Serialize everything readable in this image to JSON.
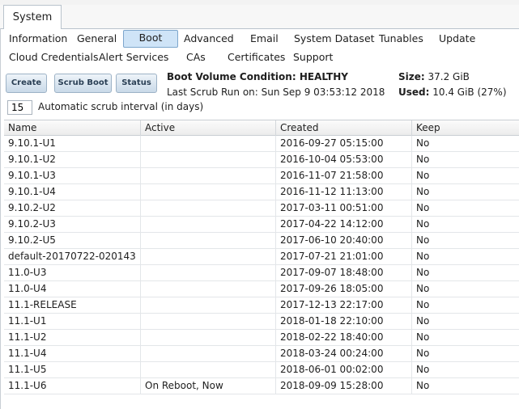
{
  "outer_tab": {
    "label": "System"
  },
  "subtabs": [
    {
      "label": "Information"
    },
    {
      "label": "General"
    },
    {
      "label": "Boot"
    },
    {
      "label": "Advanced"
    },
    {
      "label": "Email"
    },
    {
      "label": "System Dataset"
    },
    {
      "label": "Tunables"
    },
    {
      "label": "Update"
    },
    {
      "label": "Cloud Credentials"
    },
    {
      "label": "Alert Services"
    },
    {
      "label": "CAs"
    },
    {
      "label": "Certificates"
    },
    {
      "label": "Support"
    }
  ],
  "toolbar": {
    "create_label": "Create",
    "scrub_boot_label": "Scrub Boot",
    "status_label": "Status"
  },
  "boot_info": {
    "condition_label": "Boot Volume Condition:",
    "condition_value": "HEALTHY",
    "last_scrub": "Last Scrub Run on: Sun Sep 9 03:53:12 2018",
    "size_label": "Size:",
    "size_value": "37.2 GiB",
    "used_label": "Used:",
    "used_value": "10.4 GiB (27%)"
  },
  "scrub_interval": {
    "value": "15",
    "label": "Automatic scrub interval (in days)"
  },
  "table": {
    "columns": [
      "Name",
      "Active",
      "Created",
      "Keep"
    ],
    "rows": [
      {
        "name": "9.10.1-U1",
        "active": "",
        "created": "2016-09-27 05:15:00",
        "keep": "No"
      },
      {
        "name": "9.10.1-U2",
        "active": "",
        "created": "2016-10-04 05:53:00",
        "keep": "No"
      },
      {
        "name": "9.10.1-U3",
        "active": "",
        "created": "2016-11-07 21:58:00",
        "keep": "No"
      },
      {
        "name": "9.10.1-U4",
        "active": "",
        "created": "2016-11-12 11:13:00",
        "keep": "No"
      },
      {
        "name": "9.10.2-U2",
        "active": "",
        "created": "2017-03-11 00:51:00",
        "keep": "No"
      },
      {
        "name": "9.10.2-U3",
        "active": "",
        "created": "2017-04-22 14:12:00",
        "keep": "No"
      },
      {
        "name": "9.10.2-U5",
        "active": "",
        "created": "2017-06-10 20:40:00",
        "keep": "No"
      },
      {
        "name": "default-20170722-020143",
        "active": "",
        "created": "2017-07-21 21:01:00",
        "keep": "No"
      },
      {
        "name": "11.0-U3",
        "active": "",
        "created": "2017-09-07 18:48:00",
        "keep": "No"
      },
      {
        "name": "11.0-U4",
        "active": "",
        "created": "2017-09-26 18:05:00",
        "keep": "No"
      },
      {
        "name": "11.1-RELEASE",
        "active": "",
        "created": "2017-12-13 22:17:00",
        "keep": "No"
      },
      {
        "name": "11.1-U1",
        "active": "",
        "created": "2018-01-18 22:10:00",
        "keep": "No"
      },
      {
        "name": "11.1-U2",
        "active": "",
        "created": "2018-02-22 18:40:00",
        "keep": "No"
      },
      {
        "name": "11.1-U4",
        "active": "",
        "created": "2018-03-24 00:24:00",
        "keep": "No"
      },
      {
        "name": "11.1-U5",
        "active": "",
        "created": "2018-06-01 00:02:00",
        "keep": "No"
      },
      {
        "name": "11.1-U6",
        "active": "On Reboot, Now",
        "created": "2018-09-09 15:28:00",
        "keep": "No"
      }
    ]
  }
}
